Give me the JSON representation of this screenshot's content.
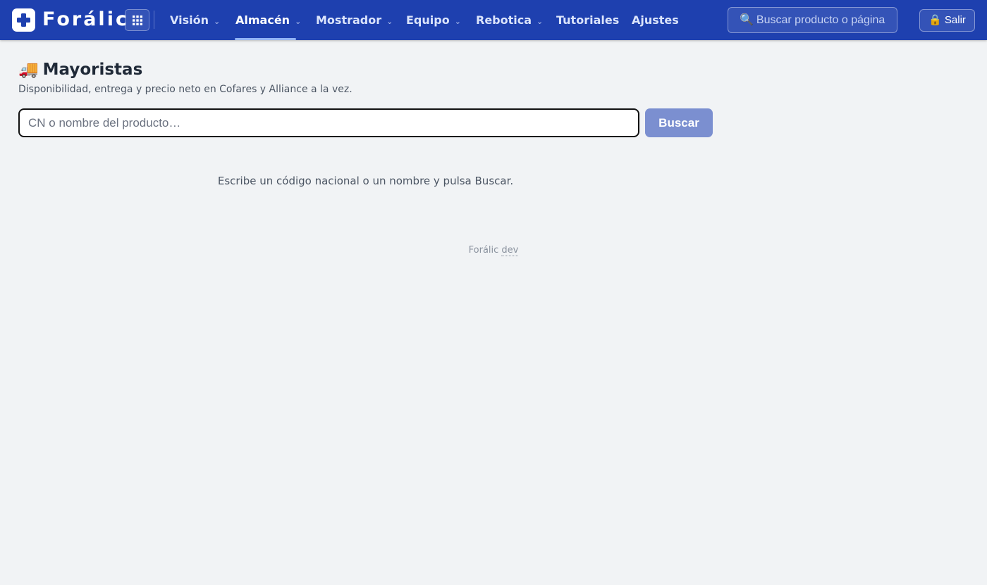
{
  "topbar": {
    "brand": "Forálic",
    "nav": [
      {
        "label": "Visión",
        "has_menu": true,
        "active": false
      },
      {
        "label": "Almacén",
        "has_menu": true,
        "active": true
      },
      {
        "label": "Mostrador",
        "has_menu": true,
        "active": false
      },
      {
        "label": "Equipo",
        "has_menu": true,
        "active": false
      },
      {
        "label": "Rebotica",
        "has_menu": true,
        "active": false
      },
      {
        "label": "Tutoriales",
        "has_menu": false,
        "active": false
      },
      {
        "label": "Ajustes",
        "has_menu": false,
        "active": false
      }
    ],
    "chevron": "⌄",
    "search": {
      "icon": "🔍",
      "placeholder": "Buscar producto o página"
    },
    "exit": {
      "icon": "🔒",
      "label": "Salir"
    }
  },
  "main": {
    "title_icon": "🚚",
    "title": "Mayoristas",
    "subtitle": "Disponibilidad, entrega y precio neto en Cofares y Alliance a la vez.",
    "search": {
      "value": "",
      "placeholder": "CN o nombre del producto…",
      "button_label": "Buscar"
    },
    "hint": "Escribe un código nacional o un nombre y pulsa Buscar."
  },
  "footer": {
    "brand": "Forálic",
    "env": "dev"
  },
  "colors": {
    "topbar": "#1e40af",
    "background": "#f1f3f5",
    "button": "#7b8fd0"
  }
}
